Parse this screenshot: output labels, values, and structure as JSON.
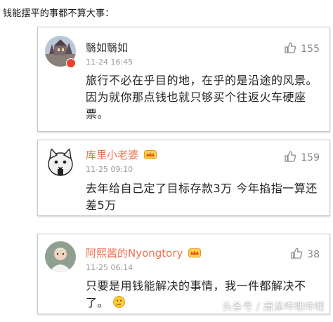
{
  "header": {
    "title": "钱能摆平的事都不算大事："
  },
  "comments": [
    {
      "username": "翳如翳如",
      "time": "11-24 16:45",
      "likes": "155",
      "text": "旅行不必在乎目的地，在乎的是沿途的风景。因为就你那点钱也就只够买个往返火车硬座票。",
      "verified_badge_color": "#e8412f"
    },
    {
      "username": "库里小老婆",
      "time": "11-25 09:10",
      "likes": "159",
      "text": "去年给自己定了目标存款3万  今年掐指一算还差5万",
      "username_color": "#eb7350"
    },
    {
      "username": "阿熙酱的Nyongtory",
      "time": "11-25 06:14",
      "likes": "38",
      "text": "只要是用钱能解决的事情，我一件都解决不了。",
      "username_color": "#eb7350"
    }
  ],
  "icons": {
    "like": "thumbs-up-icon",
    "vip": "vip-crown-icon",
    "emoji": "thinking-face-icon"
  },
  "watermark": "头条号 / 唐泽哔哩哔哩"
}
